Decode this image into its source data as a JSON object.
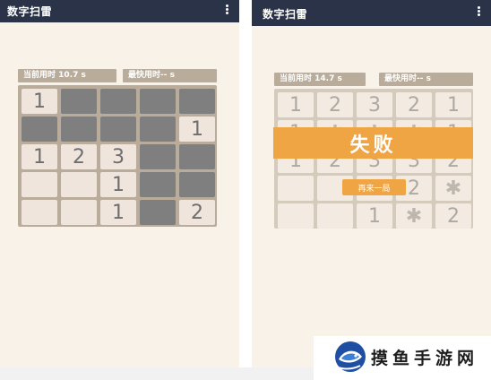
{
  "left": {
    "app_title": "数字扫雷",
    "current_time_label": "当前用时 10.7 s",
    "best_time_label": "最快用时-- s",
    "cells": [
      {
        "t": "1",
        "s": "open"
      },
      {
        "t": "",
        "s": "hidden"
      },
      {
        "t": "",
        "s": "hidden"
      },
      {
        "t": "",
        "s": "hidden"
      },
      {
        "t": "",
        "s": "hidden"
      },
      {
        "t": "",
        "s": "hidden"
      },
      {
        "t": "",
        "s": "hidden"
      },
      {
        "t": "",
        "s": "hidden"
      },
      {
        "t": "",
        "s": "hidden"
      },
      {
        "t": "1",
        "s": "open"
      },
      {
        "t": "1",
        "s": "open"
      },
      {
        "t": "2",
        "s": "open"
      },
      {
        "t": "3",
        "s": "open"
      },
      {
        "t": "",
        "s": "hidden"
      },
      {
        "t": "",
        "s": "hidden"
      },
      {
        "t": "",
        "s": "open"
      },
      {
        "t": "",
        "s": "open"
      },
      {
        "t": "1",
        "s": "open"
      },
      {
        "t": "",
        "s": "hidden"
      },
      {
        "t": "",
        "s": "hidden"
      },
      {
        "t": "",
        "s": "open"
      },
      {
        "t": "",
        "s": "open"
      },
      {
        "t": "1",
        "s": "open"
      },
      {
        "t": "",
        "s": "hidden"
      },
      {
        "t": "2",
        "s": "open"
      }
    ]
  },
  "right": {
    "app_title": "数字扫雷",
    "current_time_label": "当前用时 14.7 s",
    "best_time_label": "最快用时-- s",
    "cells": [
      {
        "t": "1",
        "s": "open"
      },
      {
        "t": "2",
        "s": "open"
      },
      {
        "t": "3",
        "s": "open"
      },
      {
        "t": "2",
        "s": "open"
      },
      {
        "t": "1",
        "s": "open"
      },
      {
        "t": "1",
        "s": "open"
      },
      {
        "t": "",
        "s": "mine"
      },
      {
        "t": "",
        "s": "mine"
      },
      {
        "t": "",
        "s": "mine"
      },
      {
        "t": "1",
        "s": "open"
      },
      {
        "t": "1",
        "s": "open"
      },
      {
        "t": "2",
        "s": "open"
      },
      {
        "t": "3",
        "s": "open"
      },
      {
        "t": "3",
        "s": "open"
      },
      {
        "t": "2",
        "s": "open"
      },
      {
        "t": "",
        "s": "open"
      },
      {
        "t": "",
        "s": "open"
      },
      {
        "t": "",
        "s": "open"
      },
      {
        "t": "2",
        "s": "open"
      },
      {
        "t": "",
        "s": "mine"
      },
      {
        "t": "",
        "s": "open"
      },
      {
        "t": "",
        "s": "open"
      },
      {
        "t": "1",
        "s": "open"
      },
      {
        "t": "",
        "s": "mine"
      },
      {
        "t": "2",
        "s": "open"
      }
    ],
    "fail_text": "失败",
    "retry_label": "再来一局"
  },
  "watermark": {
    "text": "摸鱼手游网"
  },
  "colors": {
    "appbar": "#2a3347",
    "accent": "#f0a544",
    "board": "#b9ac9b",
    "cell_open": "#efe5dc",
    "cell_hidden": "#7f7f7f"
  },
  "icons": {
    "menu": "more-vert-icon",
    "mine": "mine-icon",
    "logo": "fish-logo-icon"
  }
}
